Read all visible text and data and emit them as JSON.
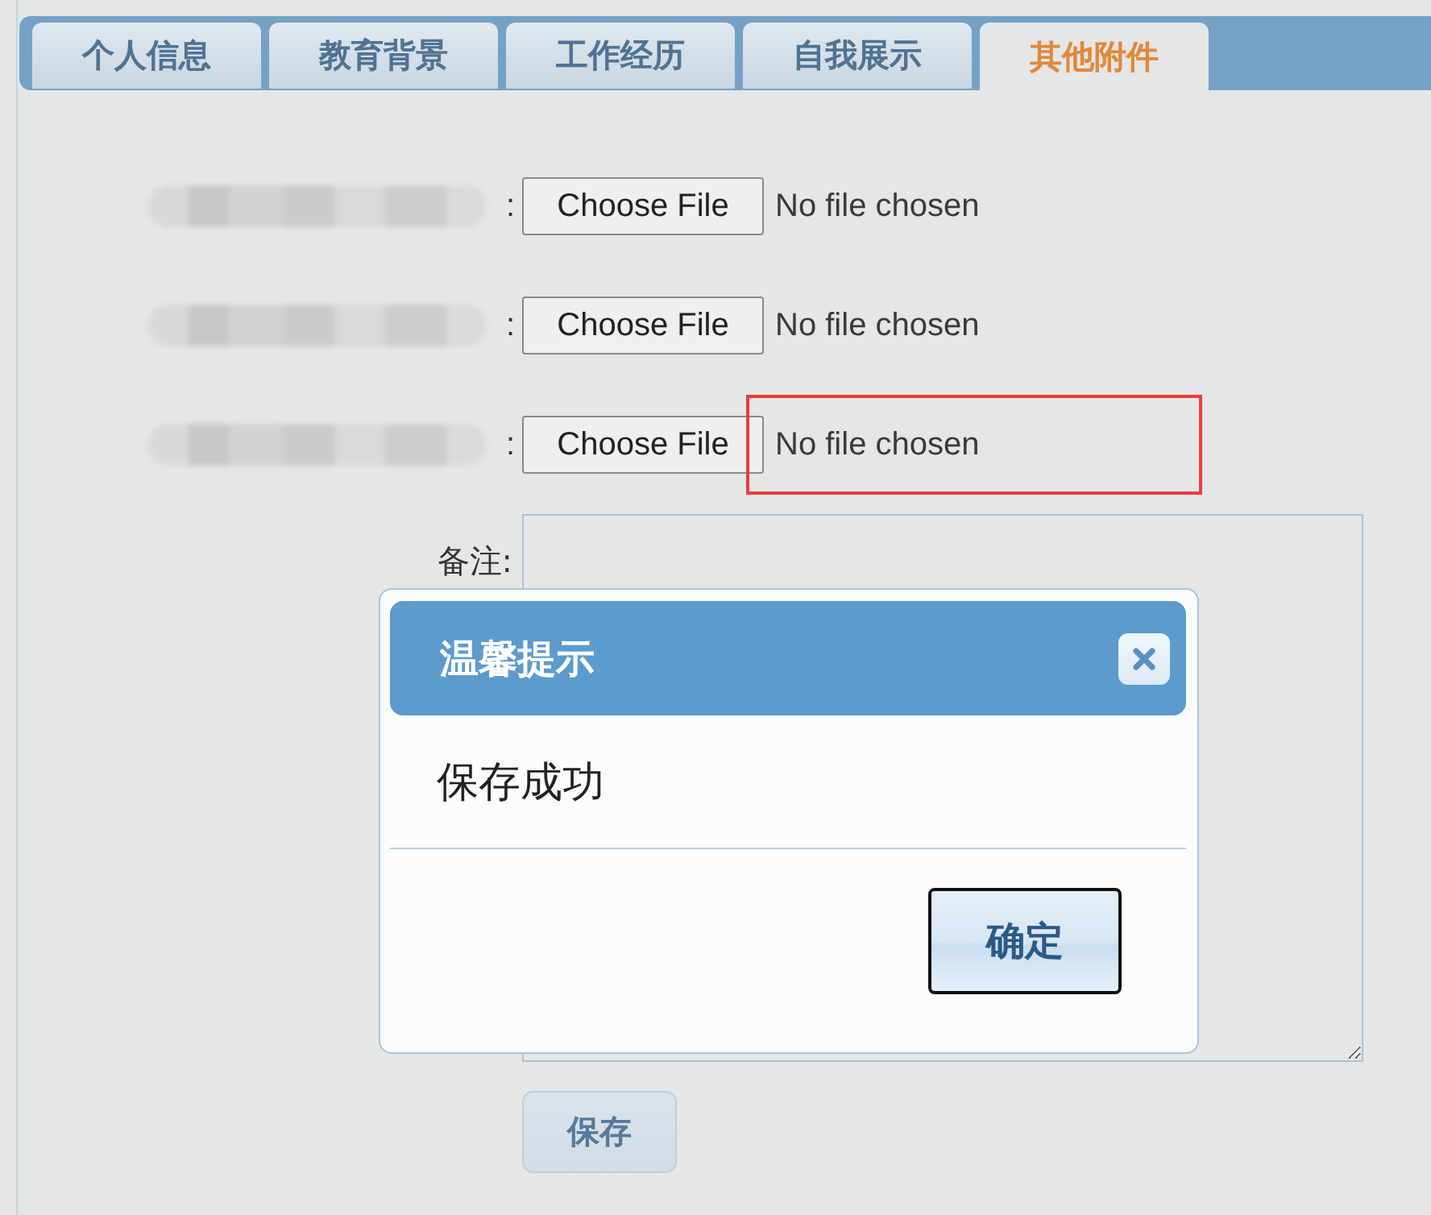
{
  "tabs": [
    {
      "label": "个人信息",
      "selected": false
    },
    {
      "label": "教育背景",
      "selected": false
    },
    {
      "label": "工作经历",
      "selected": false
    },
    {
      "label": "自我展示",
      "selected": false
    },
    {
      "label": "其他附件",
      "selected": true
    }
  ],
  "attachments": [
    {
      "label_redacted": true,
      "colon": ":",
      "button": "Choose File",
      "status": "No file chosen",
      "highlighted": false
    },
    {
      "label_redacted": true,
      "colon": ":",
      "button": "Choose File",
      "status": "No file chosen",
      "highlighted": false
    },
    {
      "label_redacted": true,
      "colon": ":",
      "button": "Choose File",
      "status": "No file chosen",
      "highlighted": true
    }
  ],
  "remarks": {
    "label": "备注:"
  },
  "save_button": "保存",
  "dialog": {
    "title": "温馨提示",
    "message": "保存成功",
    "confirm_button": "确定"
  }
}
